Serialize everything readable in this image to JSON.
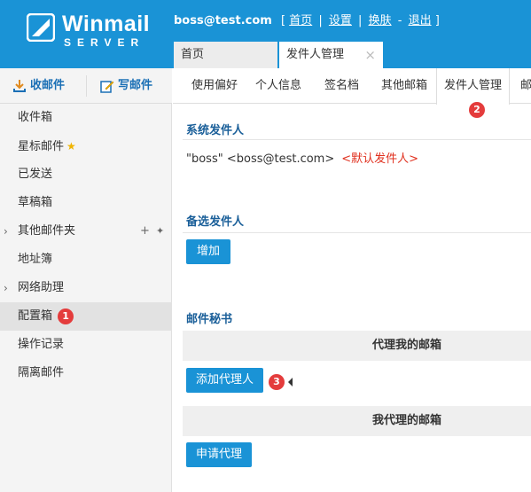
{
  "app": {
    "logo_text": "Winmail",
    "logo_sub": "SERVER",
    "user_email": "boss@test.com",
    "top_links": [
      "首页",
      "设置",
      "换肤",
      "退出"
    ],
    "bracket_open": "[",
    "bracket_close": "]",
    "sep_pipe": "|",
    "sep_dash": "-"
  },
  "tabs": {
    "home": "首页",
    "sender": "发件人管理",
    "close_glyph": "×"
  },
  "sidebar": {
    "receive_label": "收邮件",
    "write_label": "写邮件",
    "items": [
      {
        "label": "收件箱"
      },
      {
        "label": "星标邮件"
      },
      {
        "label": "已发送"
      },
      {
        "label": "草稿箱"
      },
      {
        "label": "其他邮件夹"
      },
      {
        "label": "地址簿"
      },
      {
        "label": "网络助理"
      },
      {
        "label": "配置箱"
      },
      {
        "label": "操作记录"
      },
      {
        "label": "隔离邮件"
      }
    ],
    "badge1": "1",
    "caret_glyph": "›",
    "plus_glyph": "+",
    "star_glyph": "★",
    "pin_glyph": "✦"
  },
  "subtabs": [
    "使用偏好",
    "个人信息",
    "签名档",
    "其他邮箱",
    "发件人管理",
    "邮"
  ],
  "badge2": "2",
  "badge3": "3",
  "system_sender": {
    "title": "系统发件人",
    "value": "\"boss\" <boss@test.com>",
    "default_tag": "<默认发件人>"
  },
  "alt_sender": {
    "title": "备选发件人",
    "add_button": "增加"
  },
  "secretary": {
    "title": "邮件秘书",
    "proxy_me_header": "代理我的邮箱",
    "add_agent_button": "添加代理人",
    "i_proxy_header": "我代理的邮箱",
    "apply_button": "申请代理"
  },
  "colors": {
    "header_blue": "#1a93d6",
    "title_blue": "#1a5f99",
    "badge_red": "#e43c3c",
    "default_red": "#e0301e"
  }
}
